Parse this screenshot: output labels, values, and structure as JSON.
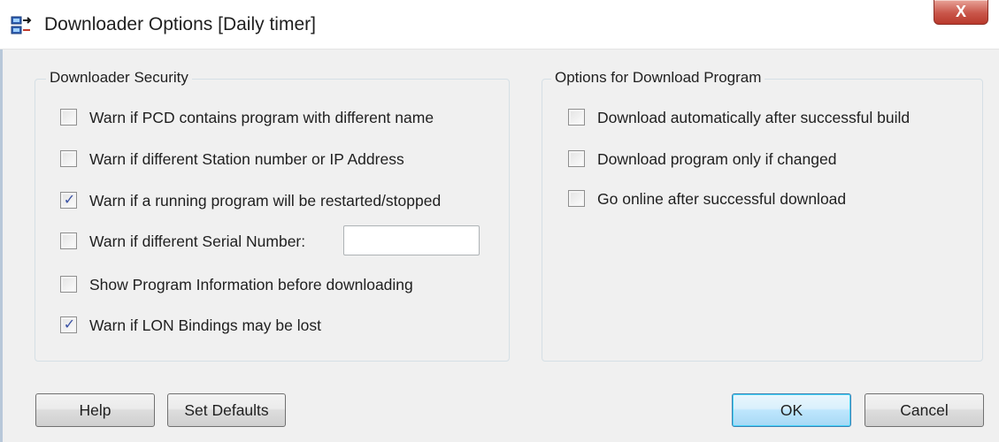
{
  "window": {
    "title": "Downloader Options [Daily timer]",
    "close_label": "X",
    "icons": {
      "app": "downloader-app-icon",
      "close": "close-icon"
    }
  },
  "security_group": {
    "title": "Downloader Security",
    "options": [
      {
        "label": "Warn if PCD contains program with different name",
        "checked": false
      },
      {
        "label": "Warn if different Station number or IP Address",
        "checked": false
      },
      {
        "label": "Warn if a running program will be restarted/stopped",
        "checked": true
      },
      {
        "label": "Warn if different Serial Number:",
        "checked": false
      },
      {
        "label": "Show Program Information before downloading",
        "checked": false
      },
      {
        "label": "Warn if LON Bindings may be lost",
        "checked": true
      }
    ],
    "serial_number_value": ""
  },
  "download_group": {
    "title": "Options for Download Program",
    "options": [
      {
        "label": "Download automatically after successful build",
        "checked": false
      },
      {
        "label": "Download program only if changed",
        "checked": false
      },
      {
        "label": "Go online after successful download",
        "checked": false
      }
    ]
  },
  "buttons": {
    "help": "Help",
    "set_defaults": "Set Defaults",
    "ok": "OK",
    "cancel": "Cancel"
  },
  "colors": {
    "dialog_bg": "#f0f0f0",
    "check_mark": "#3a52a4",
    "close_button": "#c9564a",
    "ok_button_border": "#3c7fb1"
  }
}
